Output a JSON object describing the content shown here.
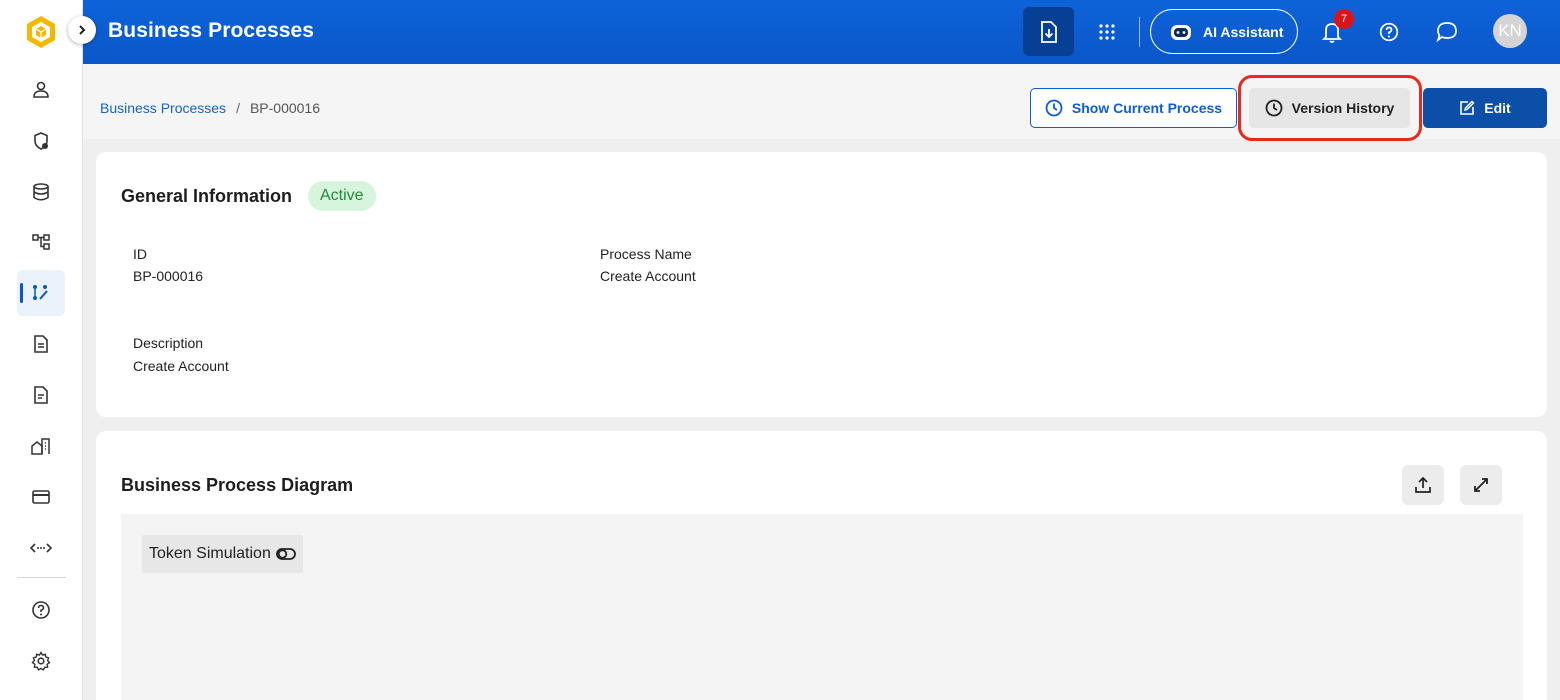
{
  "header": {
    "title": "Business Processes",
    "ai_assistant_label": "AI Assistant",
    "notification_count": "7",
    "user_initials": "KN"
  },
  "breadcrumb": {
    "parent": "Business Processes",
    "separator": "/",
    "current": "BP-000016"
  },
  "actions": {
    "show_current_label": "Show Current Process",
    "version_history_label": "Version History",
    "edit_label": "Edit"
  },
  "general_info": {
    "title": "General Information",
    "status": "Active",
    "fields": {
      "id_label": "ID",
      "id_value": "BP-000016",
      "name_label": "Process Name",
      "name_value": "Create Account",
      "description_label": "Description",
      "description_value": "Create Account"
    }
  },
  "diagram": {
    "title": "Business Process Diagram",
    "token_simulation_label": "Token Simulation"
  },
  "sidebar": {
    "items": [
      {
        "icon": "user-icon"
      },
      {
        "icon": "shield-icon"
      },
      {
        "icon": "database-icon"
      },
      {
        "icon": "hierarchy-icon"
      },
      {
        "icon": "process-flow-icon",
        "active": true
      },
      {
        "icon": "document-icon"
      },
      {
        "icon": "file-icon"
      },
      {
        "icon": "building-icon"
      },
      {
        "icon": "card-icon"
      },
      {
        "icon": "api-icon"
      },
      {
        "icon": "help-icon"
      },
      {
        "icon": "settings-icon"
      }
    ]
  },
  "colors": {
    "header_blue": "#0b5ed7",
    "edit_button": "#0b4fa8",
    "active_badge_bg": "#d6f5dc",
    "active_badge_text": "#1e8a3c",
    "highlight_red": "#e8291b",
    "logo_yellow": "#f5b800"
  }
}
